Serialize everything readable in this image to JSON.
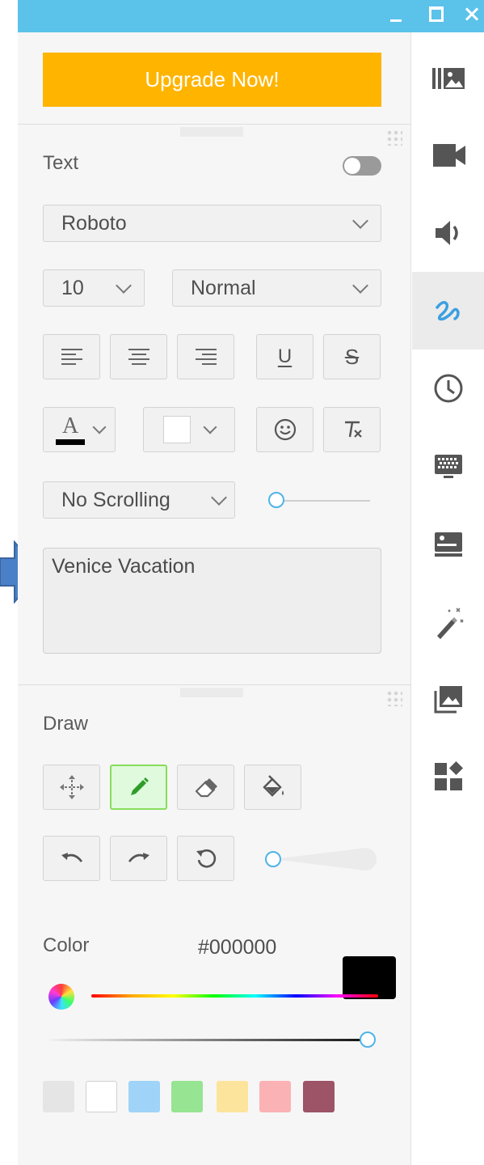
{
  "window": {
    "controls": [
      "minimize-icon",
      "maximize-icon",
      "close-icon"
    ],
    "titlebar_color": "#5bc2ea"
  },
  "upgrade": {
    "label": "Upgrade Now!",
    "color": "#ffb400"
  },
  "text_section": {
    "title": "Text",
    "toggle_on": false,
    "font_family": "Roboto",
    "font_size": "10",
    "font_weight": "Normal",
    "buttons": [
      "align-left-icon",
      "align-center-icon",
      "align-right-icon",
      "underline-icon",
      "strikethrough-icon",
      "font-color-icon",
      "background-color-icon",
      "emoji-icon",
      "clear-format-icon"
    ],
    "underline_glyph": "U",
    "strike_glyph": "S",
    "font_color_glyph": "A",
    "scroll_mode": "No Scrolling",
    "scroll_speed": 0.0,
    "content": "Venice Vacation"
  },
  "draw_section": {
    "title": "Draw",
    "tools": [
      "move-icon",
      "pencil-icon",
      "eraser-icon",
      "fill-bucket-icon"
    ],
    "active_tool": "pencil-icon",
    "history": [
      "undo-icon",
      "redo-icon",
      "reset-icon"
    ],
    "brush_size": 0.0,
    "color_label": "Color",
    "color_hex": "#000000",
    "hue": 1.0,
    "opacity": 1.0,
    "swatches": [
      "#e5e5e5",
      "#ffffff",
      "#9fd3f7",
      "#97e492",
      "#fde49c",
      "#fbb2b4",
      "#9c5466"
    ],
    "accent": "#88dd5a"
  },
  "sidebar": {
    "items": [
      "layout-icon",
      "video-icon",
      "audio-icon",
      "draw-icon",
      "clock-icon",
      "keyboard-display-icon",
      "presentation-icon",
      "magic-wand-icon",
      "gallery-icon",
      "apps-icon"
    ],
    "active": "draw-icon"
  }
}
